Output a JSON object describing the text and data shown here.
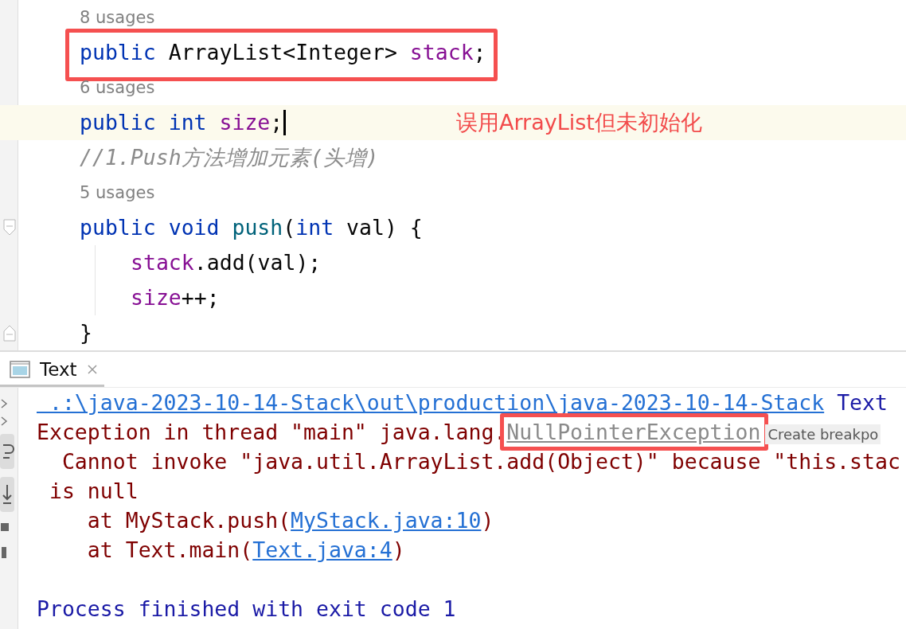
{
  "editor": {
    "lines": [
      {
        "kind": "usages",
        "text": "8 usages"
      },
      {
        "kind": "code",
        "boxed": true,
        "current": false,
        "tokens": [
          {
            "kind": "kw",
            "text": "public "
          },
          {
            "kind": "plain",
            "text": "ArrayList<Integer> "
          },
          {
            "kind": "field",
            "text": "stack"
          },
          {
            "kind": "plain",
            "text": ";"
          }
        ]
      },
      {
        "kind": "usages",
        "text": "6 usages"
      },
      {
        "kind": "code",
        "boxed": false,
        "current": true,
        "caret": true,
        "tokens": [
          {
            "kind": "kw",
            "text": "public int "
          },
          {
            "kind": "field",
            "text": "size"
          },
          {
            "kind": "plain",
            "text": ";"
          }
        ],
        "note": "误用ArrayList但未初始化"
      },
      {
        "kind": "comment",
        "text": "//1.Push方法增加元素(头增)"
      },
      {
        "kind": "usages",
        "text": "5 usages"
      },
      {
        "kind": "code",
        "boxed": false,
        "current": false,
        "fold_start": true,
        "tokens": [
          {
            "kind": "kw",
            "text": "public void "
          },
          {
            "kind": "fn",
            "text": "push"
          },
          {
            "kind": "plain",
            "text": "("
          },
          {
            "kind": "kw",
            "text": "int "
          },
          {
            "kind": "plain",
            "text": "val) {"
          }
        ],
        "children": [
          {
            "kind": "code",
            "boxed": false,
            "current": false,
            "tokens": [
              {
                "kind": "field",
                "text": "stack"
              },
              {
                "kind": "plain",
                "text": ".add(val);"
              }
            ]
          },
          {
            "kind": "code",
            "boxed": false,
            "current": false,
            "tokens": [
              {
                "kind": "field",
                "text": "size"
              },
              {
                "kind": "plain",
                "text": "++;"
              }
            ]
          }
        ]
      },
      {
        "kind": "code",
        "boxed": false,
        "current": false,
        "fold_end": true,
        "tokens": [
          {
            "kind": "plain",
            "text": "}"
          }
        ]
      }
    ]
  },
  "run_panel": {
    "tabs": [
      {
        "label": "Text",
        "selected": true,
        "closable": true
      }
    ],
    "console": [
      {
        "kind": "output",
        "tokens": [
          {
            "kind": "link",
            "text": " .:\\java-2023-10-14-Stack\\out\\production\\java-2023-10-14-Stack"
          },
          {
            "kind": "path",
            "text": " Text"
          }
        ]
      },
      {
        "kind": "output",
        "tokens": [
          {
            "kind": "error",
            "text": "Exception in thread \"main\" java.lang."
          },
          {
            "kind": "muted-link",
            "text": "NullPointerException",
            "boxed": true
          },
          {
            "kind": "hint",
            "text": "Create breakpo"
          }
        ]
      },
      {
        "kind": "output",
        "tokens": [
          {
            "kind": "error",
            "text": "  Cannot invoke \"java.util.ArrayList.add(Object)\" because \"this.stac"
          }
        ]
      },
      {
        "kind": "output",
        "tokens": [
          {
            "kind": "error",
            "text": " is null"
          }
        ]
      },
      {
        "kind": "output",
        "tokens": [
          {
            "kind": "error",
            "text": "    at MyStack.push("
          },
          {
            "kind": "link",
            "text": "MyStack.java:10"
          },
          {
            "kind": "error",
            "text": ")"
          }
        ]
      },
      {
        "kind": "output",
        "tokens": [
          {
            "kind": "error",
            "text": "    at Text.main("
          },
          {
            "kind": "link",
            "text": "Text.java:4"
          },
          {
            "kind": "error",
            "text": ")"
          }
        ]
      },
      {
        "kind": "blank"
      },
      {
        "kind": "output",
        "tokens": [
          {
            "kind": "exit",
            "text": "Process finished with exit code 1"
          }
        ]
      }
    ]
  }
}
